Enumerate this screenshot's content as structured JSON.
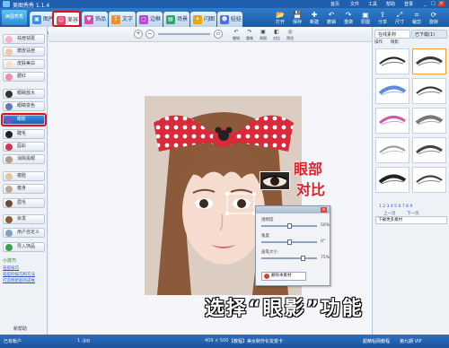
{
  "app": {
    "title": "美图秀秀 1.1.4"
  },
  "menu": [
    "首页",
    "文件",
    "工具",
    "帮助",
    "登录",
    "在线"
  ],
  "window_buttons": [
    "_",
    "□",
    "×"
  ],
  "logo": "美图秀秀",
  "tabs": [
    {
      "label": "图片处理",
      "color": "#3a8de0"
    },
    {
      "label": "美容",
      "color": "#e34a70",
      "active": true
    },
    {
      "label": "饰品",
      "color": "#d14fa8"
    },
    {
      "label": "文字",
      "color": "#f08f2a"
    },
    {
      "label": "边框",
      "color": "#b44ad2"
    },
    {
      "label": "场景",
      "color": "#2fa36b"
    },
    {
      "label": "闪图",
      "color": "#e8a800"
    },
    {
      "label": "娃娃",
      "color": "#4a6fe0"
    }
  ],
  "toolbar_buttons": [
    "打开",
    "保存",
    "新建",
    "撤销",
    "重做",
    "原图",
    "分享",
    "尺寸",
    "裁剪",
    "旋转"
  ],
  "left_panel": {
    "items": [
      "祛痘祛斑",
      "磨皮祛痘",
      "皮肤美白",
      "腮红",
      "眼睛放大",
      "眼睛变色",
      "眼影",
      "睫毛",
      "唇彩",
      "消除黑眼",
      "瘦脸",
      "瘦身",
      "眉毛",
      "染发",
      "用户自定义"
    ],
    "selected_index": 6,
    "import_label": "导入饰品",
    "tip_title": "小技巧",
    "links": [
      "祛痘技巧",
      "祛痘的技巧和方法",
      "打造明星般的皮肤"
    ],
    "footer": "新帮助"
  },
  "center_toolbar": {
    "buttons": [
      "撤销",
      "重做",
      "原图",
      "对比",
      "预览"
    ]
  },
  "photo": {
    "annotation_eye": "眼部",
    "annotation_cmp": "对比"
  },
  "float_panel": {
    "rows": [
      {
        "label": "透明度",
        "value": "50%",
        "fraction": 0.5
      },
      {
        "label": "角度",
        "value": "0°",
        "fraction": 0.5
      },
      {
        "label": "画笔大小",
        "value": "75%",
        "fraction": 0.75
      }
    ],
    "button": "删除本素材"
  },
  "right_panel": {
    "tabs": [
      "在线素材",
      "已下载(1)"
    ],
    "sub_tabs": [
      "操作",
      "眼影"
    ],
    "pagination": "1 2 3 4 5 6 7 8 9",
    "nav": [
      "上一页",
      "下一页"
    ],
    "material_text": "下载更多素材",
    "bottom_label": "下载更多素材"
  },
  "status": {
    "left": "已有帐户",
    "count": "1 .jpg",
    "size": "409 × 500",
    "center": "【教程】美女制作化妆变卡",
    "right": [
      "超精帖网教程",
      "第九期 VIP"
    ]
  },
  "caption": "选择“眼影”功能"
}
